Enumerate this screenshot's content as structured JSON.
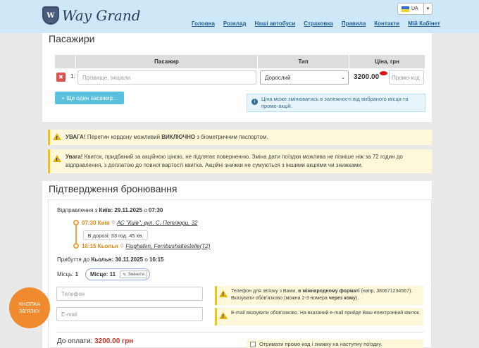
{
  "header": {
    "logo_badge": "W",
    "logo_text": "Way Grand",
    "lang": "UA",
    "nav": [
      "Головна",
      "Розклад",
      "Наші автобуси",
      "Страховка",
      "Правила",
      "Контакти",
      "Мій Кабінет"
    ]
  },
  "passengers": {
    "title": "Пасажири",
    "columns": [
      "Пасажир",
      "Тип",
      "Ціна, грн"
    ],
    "row_number": "1.",
    "name_placeholder": "Прізвище, Ініціали",
    "type_value": "Дорослий",
    "price": "3200.00",
    "promo_placeholder": "Промо-код",
    "add_button": "+ Ще один пасажир...",
    "info": "Ціна може змінюватись в залежності від вибраного місця та промо-акцій."
  },
  "warnings": {
    "w1_label": "УВАГА!",
    "w1_text_a": "Перетин кордону можливий",
    "w1_bold": "ВИКЛЮЧНО",
    "w1_text_b": "з біометричним паспортом.",
    "w2_label": "Увага!",
    "w2_text": "Квиток, придбаний за акційною ціною, не підлягає поверненню. Зміна дати поїздки можлива не пізніше ніж за 72 годин до відправлення, з доплатою до повної вартості квитка. Акційні знижки не сумуються з іншими акціями чи знижками."
  },
  "confirm": {
    "title": "Підтвердження бронювання",
    "departure_prefix": "Відправлення з",
    "departure_city_date": "Київ: 29.11.2025",
    "departure_at": "о",
    "departure_time": "07:30",
    "stop1_time": "07:30 Київ",
    "stop1_addr": "АС \"Київ\", вул. С. Петлюри, 32",
    "duration": "В дорозі: 33 год. 45 хв.",
    "stop2_time": "16:15 Кьольн",
    "stop2_addr": "Flughafen, Fernbushaltestelle(T2)",
    "arrival_prefix": "Прибуття до",
    "arrival_city_date": "Кьольн: 30.11.2025",
    "arrival_at": "о",
    "arrival_time": "16:15",
    "seats_label": "Місць:",
    "seats_count": "1",
    "seat_label": "Місце: 11",
    "change_button": "Змінити",
    "phone_placeholder": "Телефон",
    "email_placeholder": "E-mail",
    "phone_note_a": "Телефон для зв'язку з Вами,",
    "phone_note_bold": "в міжнародному форматі",
    "phone_note_b": "(напр. 380671234567). Вказувати обов'язково (можна 2-3 номера",
    "phone_note_bold2": "через кому",
    "phone_note_c": ").",
    "email_note": "E-mail вказувати обов'язково. На вказаний e-mail прийде Ваш електронний квиток.",
    "to_pay_label": "До оплати:",
    "to_pay_value": "3200.00 грн",
    "promo_opt": "Отримати промо-код і знижку на наступну поїздку."
  },
  "contact_button": "КНОПКА ЗВ'ЯЗКУ"
}
